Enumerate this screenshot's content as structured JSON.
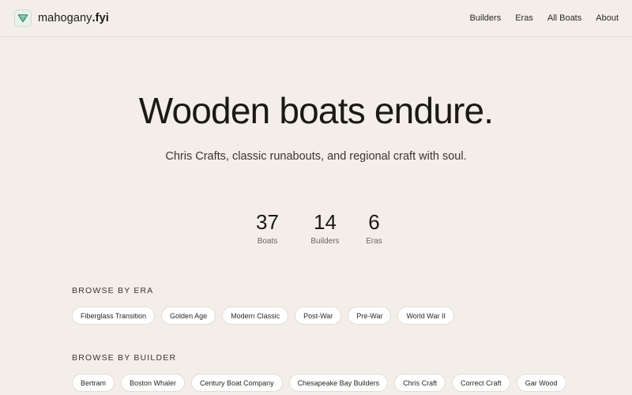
{
  "brand": {
    "name_prefix": "mahogany",
    "name_suffix": ".fyi",
    "logo_icon": "boat-icon",
    "accent": "#2f8f6a"
  },
  "nav": [
    "Builders",
    "Eras",
    "All Boats",
    "About"
  ],
  "hero": {
    "title": "Wooden boats endure.",
    "subtitle": "Chris Crafts, classic runabouts, and regional craft with soul."
  },
  "stats": [
    {
      "value": "37",
      "label": "Boats"
    },
    {
      "value": "14",
      "label": "Builders"
    },
    {
      "value": "6",
      "label": "Eras"
    }
  ],
  "browse_era": {
    "heading": "Browse by Era",
    "items": [
      "Fiberglass Transition",
      "Golden Age",
      "Modern Classic",
      "Post-War",
      "Pre-War",
      "World War II"
    ]
  },
  "browse_builder": {
    "heading": "Browse by Builder",
    "items": [
      "Bertram",
      "Boston Whaler",
      "Century Boat Company",
      "Chesapeake Bay Builders",
      "Chris Craft",
      "Correct Craft",
      "Gar Wood"
    ]
  }
}
